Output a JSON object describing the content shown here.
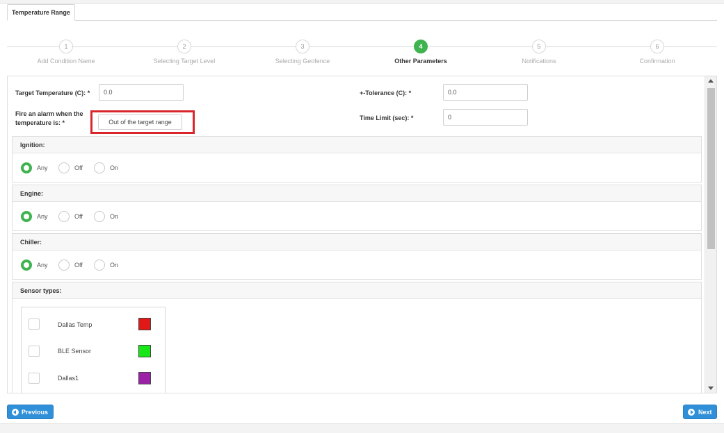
{
  "tab": {
    "label": "Temperature Range"
  },
  "steps": [
    {
      "number": "1",
      "label": "Add Condition Name"
    },
    {
      "number": "2",
      "label": "Selecting Target Level"
    },
    {
      "number": "3",
      "label": "Selecting Geofence"
    },
    {
      "number": "4",
      "label": "Other Parameters",
      "active": true
    },
    {
      "number": "5",
      "label": "Notifications"
    },
    {
      "number": "6",
      "label": "Confirmation"
    }
  ],
  "form": {
    "target_temperature": {
      "label": "Target Temperature (C):",
      "required": "*",
      "value": "0.0"
    },
    "tolerance": {
      "label": "+-Tolerance (C):",
      "required": "*",
      "value": "0.0"
    },
    "alarm": {
      "label_line1": "Fire an alarm when the",
      "label_line2": "temperature is:",
      "required": "*",
      "value": "Out of the target range"
    },
    "time_limit": {
      "label": "Time Limit (sec):",
      "required": "*",
      "value": "0"
    }
  },
  "sections": {
    "ignition": {
      "title": "Ignition:",
      "options": [
        "Any",
        "Off",
        "On"
      ],
      "selected": "Any"
    },
    "engine": {
      "title": "Engine:",
      "options": [
        "Any",
        "Off",
        "On"
      ],
      "selected": "Any"
    },
    "chiller": {
      "title": "Chiller:",
      "options": [
        "Any",
        "Off",
        "On"
      ],
      "selected": "Any"
    },
    "sensor_types": {
      "title": "Sensor types:",
      "items": [
        {
          "label": "Dallas Temp",
          "color": "#e01818",
          "checked": false
        },
        {
          "label": "BLE Sensor",
          "color": "#17e617",
          "checked": false
        },
        {
          "label": "Dallas1",
          "color": "#9b22a6",
          "checked": false
        }
      ]
    }
  },
  "buttons": {
    "previous": "Previous",
    "next": "Next"
  },
  "colors": {
    "accent_green": "#3fb34f",
    "primary_blue": "#2f8fd8",
    "highlight_red": "#d9262c"
  }
}
